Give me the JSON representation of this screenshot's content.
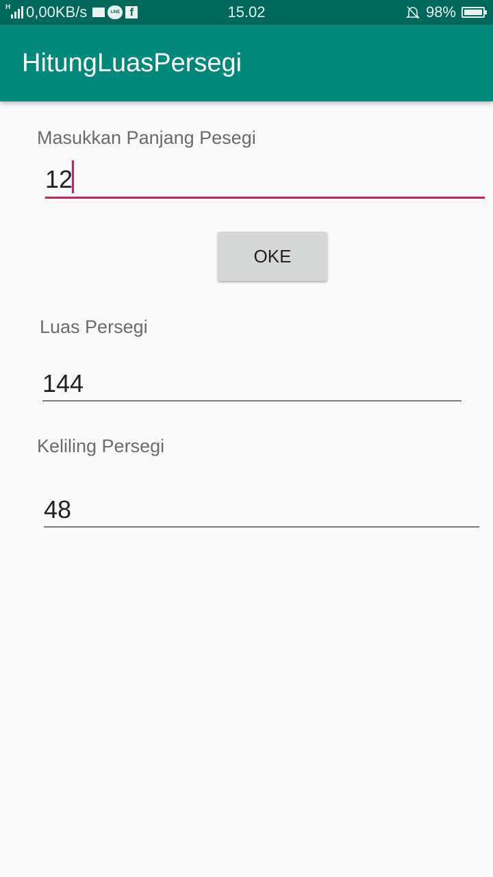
{
  "status_bar": {
    "net_type": "H",
    "speed": "0,00KB/s",
    "line_label": "LINE",
    "fb_label": "f",
    "time": "15.02",
    "battery": "98%",
    "icons": [
      "signal-icon",
      "mail-icon",
      "line-icon",
      "facebook-icon",
      "mute-bell-icon",
      "battery-icon"
    ]
  },
  "app_bar": {
    "title": "HitungLuasPersegi"
  },
  "form": {
    "length_label": "Masukkan Panjang Pesegi",
    "length_value": "12",
    "ok_label": "OKE",
    "area_label": "Luas Persegi",
    "area_value": "144",
    "perimeter_label": "Keliling Persegi",
    "perimeter_value": "48"
  },
  "colors": {
    "status_bar": "#00695c",
    "app_bar": "#00897b",
    "accent": "#d81b60",
    "background": "#fafafa"
  }
}
